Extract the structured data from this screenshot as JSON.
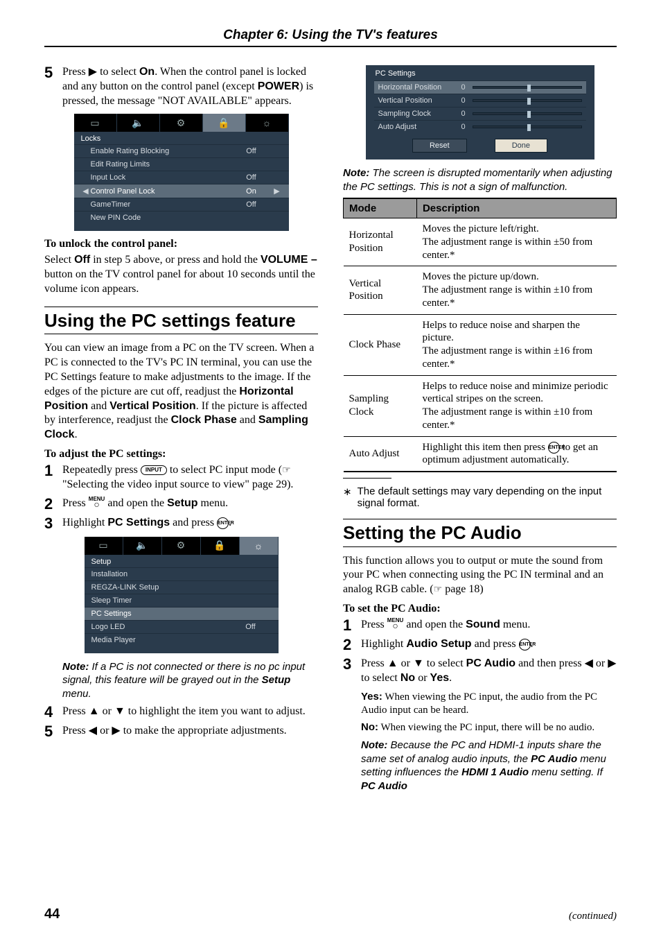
{
  "chapter_header": "Chapter 6: Using the TV's features",
  "page_number": "44",
  "continued": "(continued)",
  "left": {
    "step5": {
      "num": "5",
      "pre": "Press ",
      "arrow": "▶",
      "mid": " to select ",
      "on": "On",
      "post": ". When the control panel is locked and any button on the control panel (except ",
      "power": "POWER",
      "tail": ") is pressed, the message \"NOT AVAILABLE\" appears."
    },
    "locks_menu": {
      "tabs": [
        "▭",
        "🔈",
        "⚙",
        "🔒",
        "☼"
      ],
      "active_tab": 3,
      "title": "Locks",
      "rows": [
        {
          "label": "Enable Rating Blocking",
          "val": "Off",
          "sel": false
        },
        {
          "label": "Edit Rating Limits",
          "val": "",
          "sel": false
        },
        {
          "label": "Input Lock",
          "val": "Off",
          "sel": false
        },
        {
          "label": "Control Panel Lock",
          "val": "On",
          "sel": true,
          "arrows": true
        },
        {
          "label": "GameTimer",
          "val": "Off",
          "sel": false
        },
        {
          "label": "New PIN Code",
          "val": "",
          "sel": false
        }
      ]
    },
    "unlock_head": "To unlock the control panel:",
    "unlock_para_a": "Select ",
    "unlock_off": "Off",
    "unlock_para_b": " in step 5 above, or press and hold the ",
    "unlock_vol": "VOLUME –",
    "unlock_para_c": " button on the TV control panel for about 10 seconds until the volume icon appears.",
    "pc_heading": "Using the PC settings feature",
    "pc_para_a": "You can view an image from a PC on the TV screen. When a PC is connected to the TV's PC IN terminal, you can use the PC Settings feature to make adjustments to the image. If the edges of the picture are cut off, readjust the ",
    "pc_hp": "Horizontal Position",
    "pc_and": " and ",
    "pc_vp": "Vertical Position",
    "pc_para_b": ". If the picture is affected by interference, readjust the ",
    "pc_cp": "Clock Phase",
    "pc_and2": " and ",
    "pc_sc": "Sampling Clock",
    "pc_period": ".",
    "adjust_head": "To adjust the PC settings:",
    "a_step1": {
      "num": "1",
      "a": "Repeatedly press ",
      "btn": "INPUT",
      "b": " to select PC input mode (",
      "hand": "☞",
      "c": " \"Selecting the video input source to view\" page 29)."
    },
    "a_step2": {
      "num": "2",
      "a": "Press ",
      "menu_top": "MENU",
      "b": " and open the ",
      "setup": "Setup",
      "c": " menu."
    },
    "a_step3": {
      "num": "3",
      "a": "Highlight ",
      "pcs": "PC Settings",
      "b": " and press ",
      "enter": "ENTER",
      "c": "."
    },
    "setup_menu": {
      "tabs": [
        "▭",
        "🔈",
        "⚙",
        "🔒",
        "☼"
      ],
      "active_tab": 4,
      "title": "Setup",
      "rows": [
        {
          "label": "Installation",
          "val": "",
          "sel": false
        },
        {
          "label": "REGZA-LINK Setup",
          "val": "",
          "sel": false
        },
        {
          "label": "Sleep Timer",
          "val": "",
          "sel": false
        },
        {
          "label": "PC Settings",
          "val": "",
          "sel": true
        },
        {
          "label": "Logo LED",
          "val": "Off",
          "sel": false
        },
        {
          "label": "Media Player",
          "val": "",
          "sel": false
        }
      ]
    },
    "note1_lead": "Note:",
    "note1_body_a": " If a PC is not connected or there is no pc input signal, this feature will be grayed out in the ",
    "note1_setup": "Setup",
    "note1_body_b": " menu.",
    "a_step4": {
      "num": "4",
      "a": "Press ",
      "u": "▲",
      "or": " or ",
      "d": "▼",
      "b": " to highlight the item you want to adjust."
    },
    "a_step5": {
      "num": "5",
      "a": "Press ",
      "l": "◀",
      "or": " or ",
      "r": "▶",
      "b": " to make the appropriate adjustments."
    }
  },
  "right": {
    "pc_panel": {
      "title": "PC Settings",
      "rows": [
        {
          "label": "Horizontal Position",
          "zero": "0",
          "thumb": 50,
          "sel": true
        },
        {
          "label": "Vertical Position",
          "zero": "0",
          "thumb": 50,
          "sel": false
        },
        {
          "label": "Sampling Clock",
          "zero": "0",
          "thumb": 50,
          "sel": false
        },
        {
          "label": "Auto Adjust",
          "zero": "0",
          "thumb": 50,
          "sel": false
        }
      ],
      "reset": "Reset",
      "done": "Done"
    },
    "note2_lead": "Note:",
    "note2_body": " The screen is disrupted momentarily when adjusting the PC settings. This is not a sign of malfunction.",
    "table": {
      "head_mode": "Mode",
      "head_desc": "Description",
      "rows": [
        {
          "mode": "Horizontal Position",
          "desc": "Moves the picture left/right.\nThe adjustment range is within ±50 from center.*"
        },
        {
          "mode": "Vertical Position",
          "desc": "Moves the picture up/down.\nThe adjustment range is within ±10 from center.*"
        },
        {
          "mode": "Clock Phase",
          "desc": "Helps to reduce noise and sharpen the picture.\nThe adjustment range is within ±16 from center.*"
        },
        {
          "mode": "Sampling Clock",
          "desc": "Helps to reduce noise and minimize periodic vertical stripes on the screen.\nThe adjustment range is within ±10 from center.*"
        },
        {
          "mode": "Auto Adjust",
          "desc_pre": "Highlight this item then press ",
          "enter": "ENTER",
          "desc_post": " to get an optimum adjustment automatically."
        }
      ]
    },
    "footnote_star": "∗",
    "footnote_text": "The default settings may vary depending on the input signal format.",
    "audio_heading": "Setting the PC Audio",
    "audio_para_a": "This function allows you to output or mute the sound from your PC when connecting using the PC IN terminal and an analog RGB cable. (",
    "hand": "☞",
    "audio_para_b": " page 18)",
    "set_head": "To set the PC Audio:",
    "s_step1": {
      "num": "1",
      "a": "Press ",
      "menu_top": "MENU",
      "b": " and open the ",
      "sound": "Sound",
      "c": " menu."
    },
    "s_step2": {
      "num": "2",
      "a": "Highlight ",
      "as": "Audio Setup",
      "b": " and press ",
      "enter": "ENTER",
      "c": "."
    },
    "s_step3": {
      "num": "3",
      "a": "Press ",
      "u": "▲",
      "or": " or ",
      "d": "▼",
      "b": " to select ",
      "pca": "PC Audio",
      "c": " and then press ",
      "l": "◀",
      "or2": " or ",
      "r": "▶",
      "d2": " to select ",
      "no": "No",
      "or3": " or ",
      "yes": "Yes",
      "e": "."
    },
    "yes_lead": "Yes:",
    "yes_body": " When viewing the PC input, the audio from the PC Audio input can be heard.",
    "no_lead": "No:",
    "no_body": " When viewing the PC input, there will be no audio.",
    "note3_lead": "Note:",
    "note3_a": " Because the PC and HDMI-1 inputs share the same set of analog audio inputs, the ",
    "note3_pca": "PC Audio",
    "note3_b": " menu setting influences the ",
    "note3_h1a": "HDMI 1 Audio",
    "note3_c": " menu setting. If ",
    "note3_pca2": "PC Audio"
  }
}
